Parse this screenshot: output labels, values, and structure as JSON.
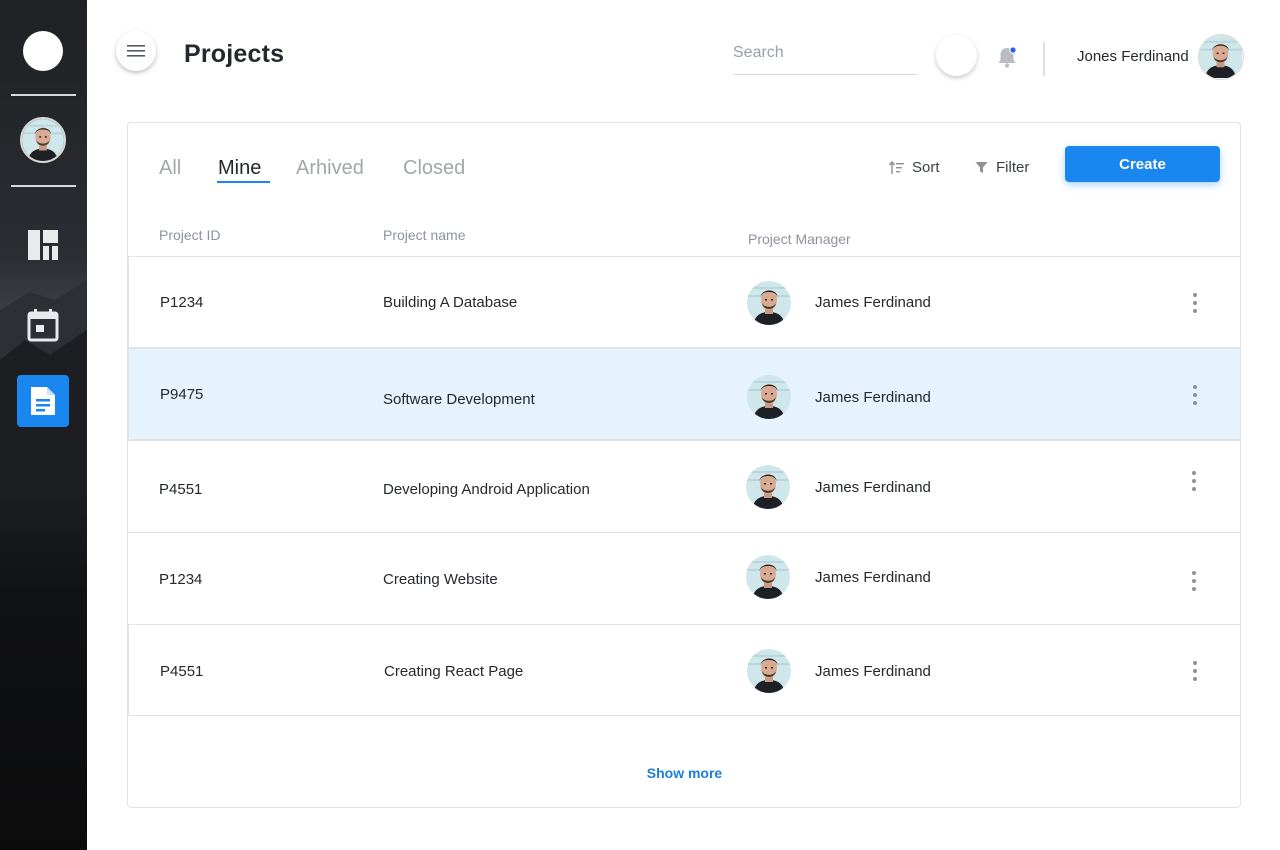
{
  "sidebar": {
    "nav_items": [
      {
        "icon": "dashboard-icon",
        "active": false
      },
      {
        "icon": "calendar-icon",
        "active": false
      },
      {
        "icon": "document-icon",
        "active": true
      }
    ]
  },
  "header": {
    "title": "Projects",
    "search_placeholder": "Search",
    "user_name": "Jones Ferdinand",
    "notification_dot_color": "#2f5bff"
  },
  "tabs": [
    {
      "label": "All",
      "active": false
    },
    {
      "label": "Mine",
      "active": true
    },
    {
      "label": "Arhived",
      "active": false
    },
    {
      "label": "Closed",
      "active": false
    }
  ],
  "toolbar": {
    "sort_label": "Sort",
    "filter_label": "Filter",
    "create_label": "Create"
  },
  "table": {
    "columns": [
      "Project ID",
      "Project name",
      "Project Manager"
    ],
    "rows": [
      {
        "id": "P1234",
        "name": "Building A Database",
        "manager": "James Ferdinand",
        "selected": false
      },
      {
        "id": "P9475",
        "name": "Software Development",
        "manager": "James Ferdinand",
        "selected": true
      },
      {
        "id": "P4551",
        "name": "Developing Android Application",
        "manager": "James Ferdinand",
        "selected": false
      },
      {
        "id": "P1234",
        "name": "Creating Website",
        "manager": "James Ferdinand",
        "selected": false
      },
      {
        "id": "P4551",
        "name": "Creating React Page",
        "manager": "James Ferdinand",
        "selected": false
      }
    ]
  },
  "show_more_label": "Show more",
  "colors": {
    "accent": "#1a86f0",
    "selected_row": "#e6f2fc",
    "sidebar_bg": "#111214"
  }
}
